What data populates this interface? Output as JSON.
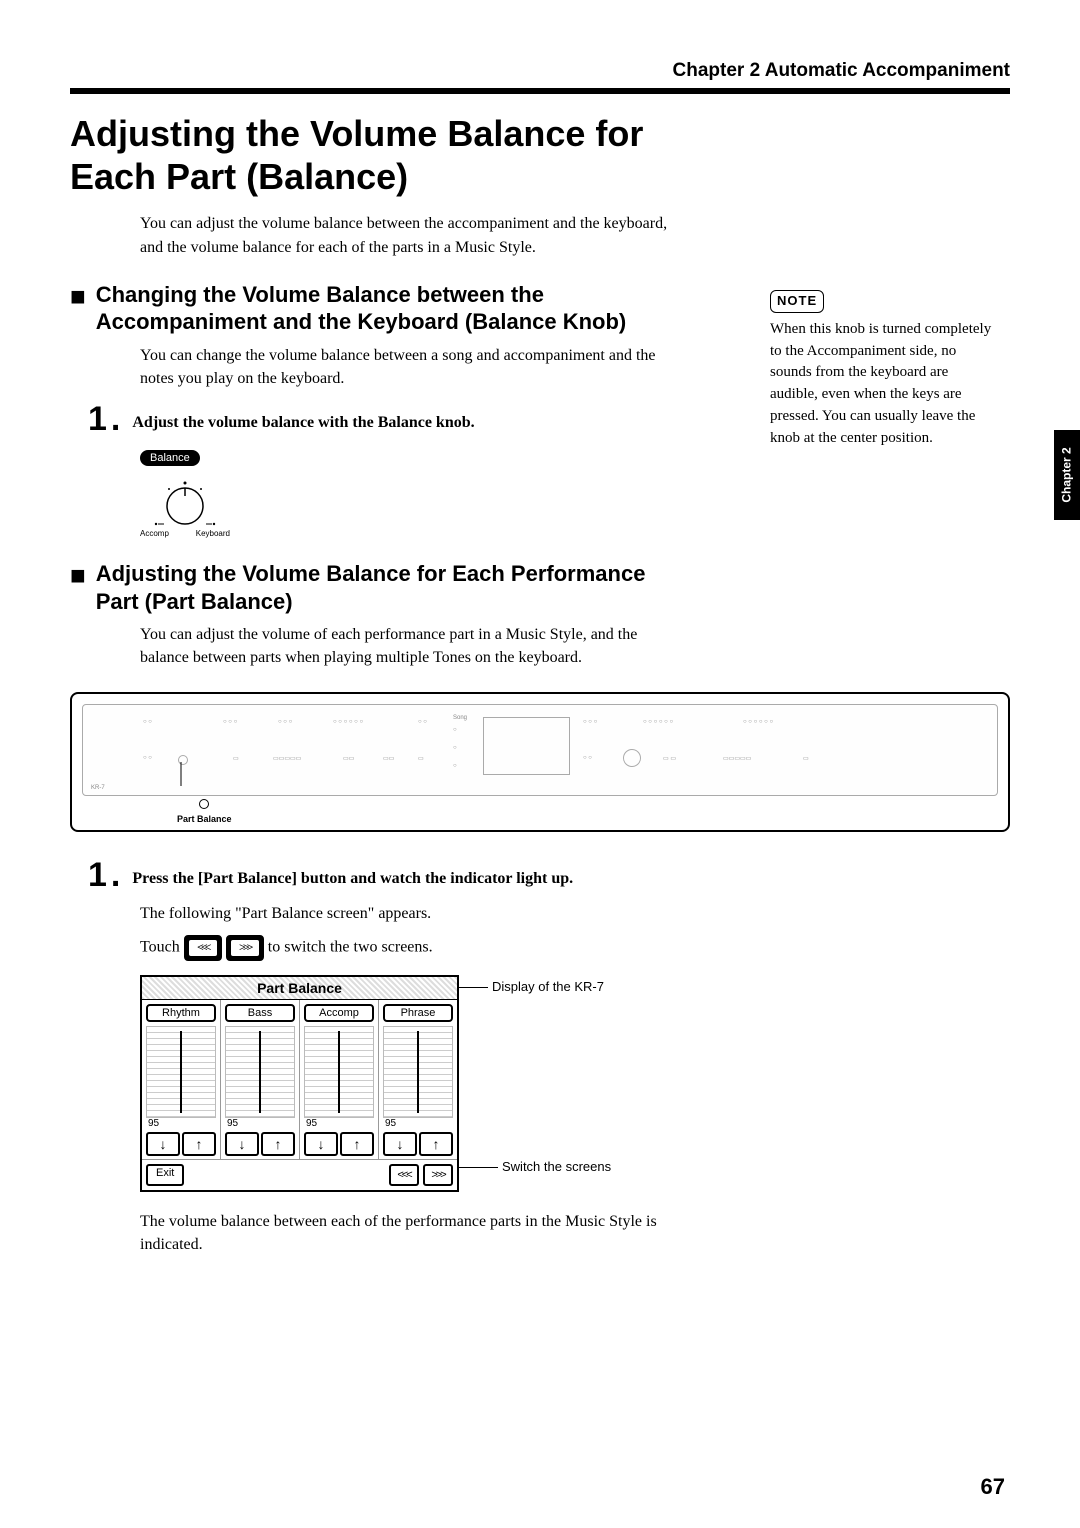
{
  "header": {
    "chapter_label": "Chapter 2  Automatic Accompaniment"
  },
  "title": "Adjusting the Volume Balance for Each Part (Balance)",
  "intro": "You can adjust the volume balance between the accompaniment and the keyboard, and the volume balance for each of the parts in a Music Style.",
  "section1": {
    "heading": "Changing the Volume Balance between the Accompaniment and the Keyboard (Balance Knob)",
    "para": "You can change the volume balance between a song and accompaniment and the notes you play on the keyboard.",
    "step_num": "1",
    "step_text": "Adjust the volume balance with the Balance knob.",
    "knob": {
      "badge": "Balance",
      "left_label": "Accomp",
      "right_label": "Keyboard"
    }
  },
  "section2": {
    "heading": "Adjusting the Volume Balance for Each Performance Part (Part Balance)",
    "para": "You can adjust the volume of each performance part in a Music Style, and the balance between parts when playing multiple Tones on the keyboard."
  },
  "panel": {
    "model": "KR-7",
    "callout": "Part Balance"
  },
  "section3": {
    "step_num": "1",
    "step_text": "Press the [Part Balance] button and watch the indicator light up.",
    "line1": "The following \"Part Balance screen\" appears.",
    "touch_prefix": "Touch ",
    "touch_suffix": " to switch the two screens.",
    "closing": "The volume balance between each of the performance parts in the Music Style is indicated."
  },
  "screen": {
    "title": "Part Balance",
    "tracks": [
      {
        "name": "Rhythm",
        "value": "95"
      },
      {
        "name": "Bass",
        "value": "95"
      },
      {
        "name": "Accomp",
        "value": "95"
      },
      {
        "name": "Phrase",
        "value": "95"
      }
    ],
    "down": "↓",
    "up": "↑",
    "exit": "Exit",
    "prev": "<<<",
    "next": ">>>",
    "annot_display": "Display of the KR-7",
    "annot_switch": "Switch the screens"
  },
  "note": {
    "label": "NOTE",
    "text": "When this knob is turned completely to the Accompaniment side, no sounds from the keyboard are audible, even when the keys are pressed. You can usually leave the knob at the center position."
  },
  "side_tab": "Chapter 2",
  "page_number": "67"
}
